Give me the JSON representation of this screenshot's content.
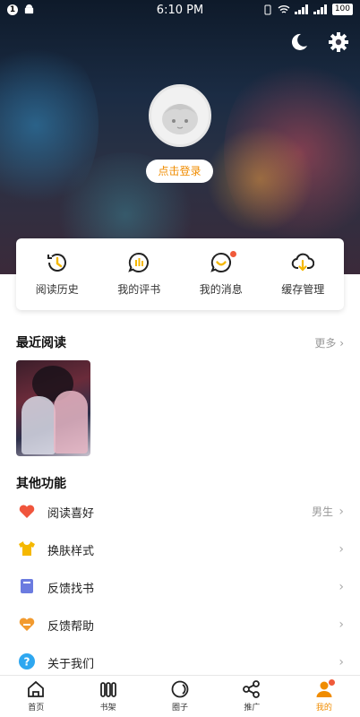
{
  "status_bar": {
    "time": "6:10 PM",
    "notif_count": "1",
    "battery": "100"
  },
  "profile": {
    "login_label": "点击登录"
  },
  "quick_actions": [
    {
      "label": "阅读历史",
      "icon": "history-icon"
    },
    {
      "label": "我的评书",
      "icon": "comment-icon"
    },
    {
      "label": "我的消息",
      "icon": "message-icon"
    },
    {
      "label": "缓存管理",
      "icon": "cloud-download-icon"
    }
  ],
  "recent": {
    "title": "最近阅读",
    "more": "更多"
  },
  "other": {
    "title": "其他功能",
    "items": [
      {
        "label": "阅读喜好",
        "value": "男生",
        "icon": "heart-icon",
        "color": "#f0553c"
      },
      {
        "label": "换肤样式",
        "value": "",
        "icon": "shirt-icon",
        "color": "#f5b800"
      },
      {
        "label": "反馈找书",
        "value": "",
        "icon": "book-icon",
        "color": "#6b7be0"
      },
      {
        "label": "反馈帮助",
        "value": "",
        "icon": "help-heart-icon",
        "color": "#f29a2e"
      },
      {
        "label": "关于我们",
        "value": "",
        "icon": "question-icon",
        "color": "#2ea7f0"
      }
    ]
  },
  "nav": [
    {
      "label": "首页",
      "icon": "home-icon"
    },
    {
      "label": "书架",
      "icon": "bookshelf-icon"
    },
    {
      "label": "圈子",
      "icon": "circle-icon"
    },
    {
      "label": "推广",
      "icon": "share-icon"
    },
    {
      "label": "我的",
      "icon": "profile-icon"
    }
  ],
  "colors": {
    "accent": "#f08c00",
    "badge": "#f05a3a"
  }
}
